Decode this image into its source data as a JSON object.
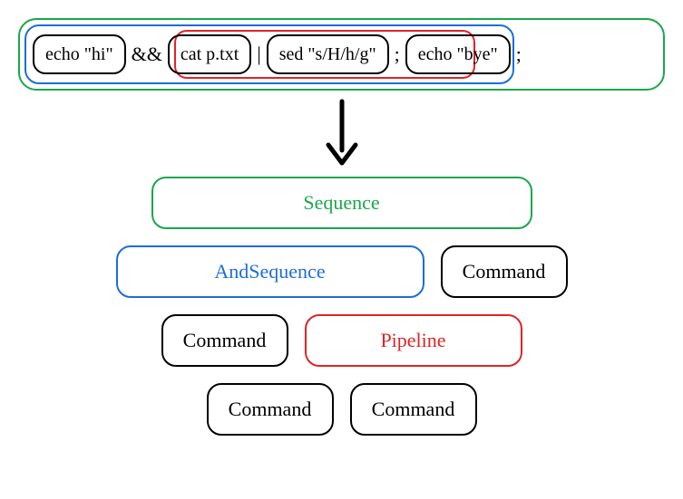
{
  "command_line": {
    "cmd1": "echo \"hi\"",
    "op_and": "&&",
    "cmd2": "cat p.txt",
    "op_pipe": "|",
    "cmd3": "sed \"s/H/h/g\"",
    "op_semi1": ";",
    "cmd4": "echo \"bye\"",
    "op_semi2": ";"
  },
  "tree": {
    "sequence": "Sequence",
    "and_sequence": "AndSequence",
    "pipeline": "Pipeline",
    "command": "Command"
  },
  "colors": {
    "green": "#1ba64c",
    "blue": "#1d6dd8",
    "red": "#e02424",
    "black": "#000000"
  }
}
